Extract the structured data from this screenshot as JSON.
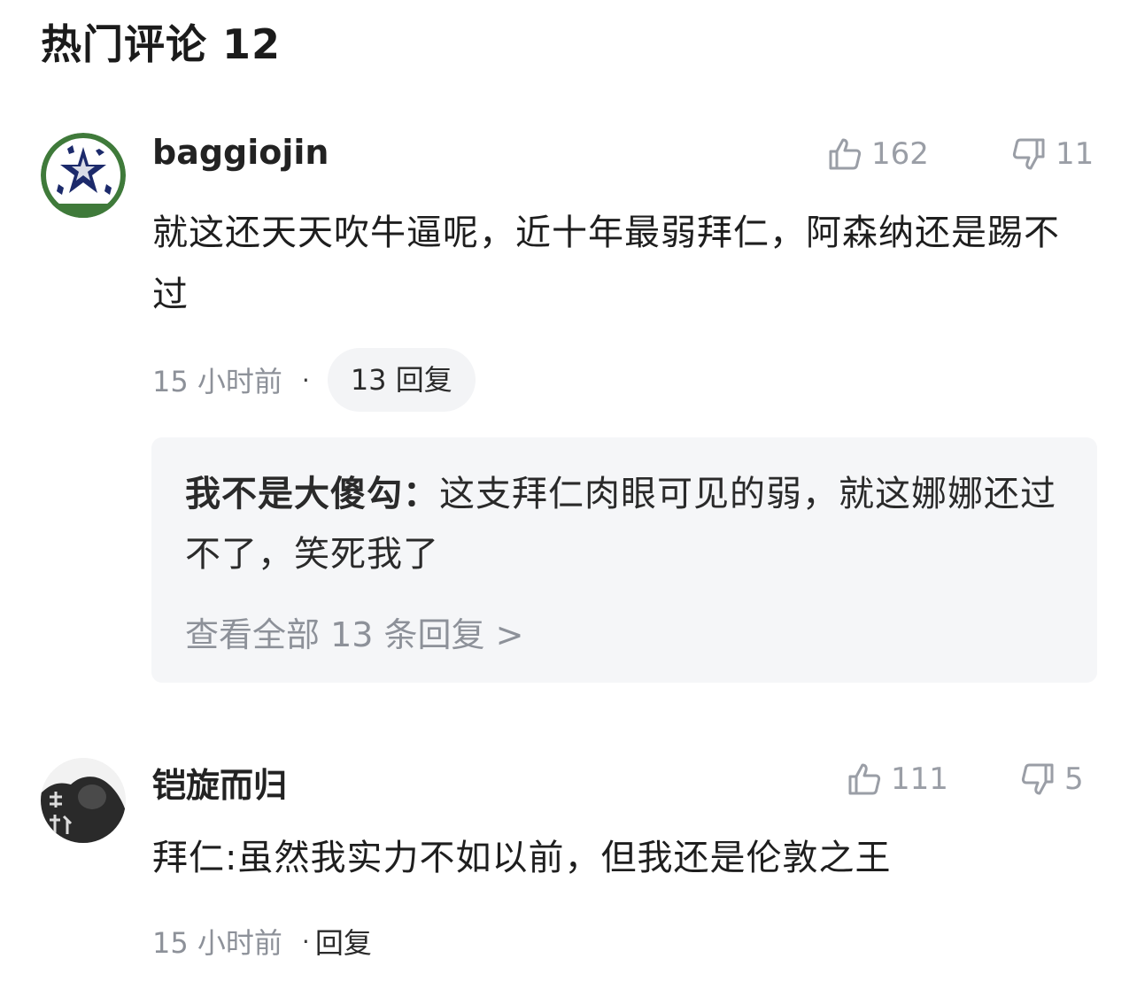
{
  "header": {
    "title": "热门评论 12"
  },
  "comments": [
    {
      "username": "baggiojin",
      "likes": "162",
      "dislikes": "11",
      "text": "就这还天天吹牛逼呢，近十年最弱拜仁，阿森纳还是踢不过",
      "time": "15 小时前",
      "dot": "·",
      "reply_label": "13 回复",
      "avatar_icon": "soccer-ball-avatar",
      "reply_preview": {
        "author": "我不是大傻勾：",
        "text": "这支拜仁肉眼可见的弱，就这娜娜还过不了，笑死我了",
        "view_all": "查看全部 13 条回复 >"
      }
    },
    {
      "username": "铠旋而归",
      "likes": "111",
      "dislikes": "5",
      "text": "拜仁:虽然我实力不如以前，但我还是伦敦之王",
      "time": "15 小时前",
      "dot": "·",
      "reply_label": "回复",
      "avatar_icon": "person-photo-avatar"
    }
  ],
  "colors": {
    "muted_text": "#8d9199",
    "reply_bg": "#f5f6f8",
    "pill_bg": "#f3f4f6"
  }
}
